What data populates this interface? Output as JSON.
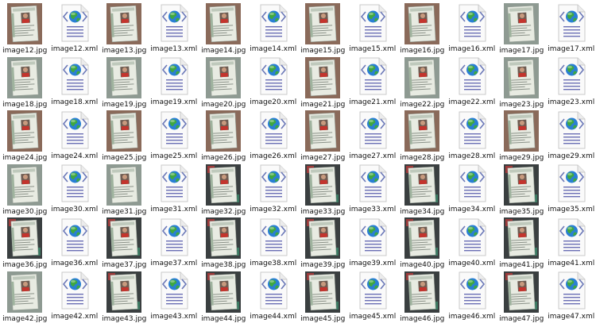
{
  "window": {
    "view": "large-icons"
  },
  "icons": {
    "jpg": "id-card-photo-thumbnail",
    "xml": "xml-document-icon"
  },
  "colors": {
    "label_text": "#111111",
    "xml_line": "#6b6fb5",
    "xml_globe_ocean": "#2a7fd4",
    "xml_globe_land": "#3fa83f",
    "xml_bracket": "#6b78b8",
    "photo_brown_bg": "#8a6a5a",
    "photo_gray_bg": "#8e9a92",
    "photo_dark_bg": "#3a3f40",
    "card_face": "#e8ebe2",
    "card_shirt": "#c4342d"
  },
  "files": [
    {
      "name": "image12.jpg",
      "type": "jpg",
      "bg": "brown"
    },
    {
      "name": "image12.xml",
      "type": "xml"
    },
    {
      "name": "image13.jpg",
      "type": "jpg",
      "bg": "brown"
    },
    {
      "name": "image13.xml",
      "type": "xml"
    },
    {
      "name": "image14.jpg",
      "type": "jpg",
      "bg": "brown"
    },
    {
      "name": "image14.xml",
      "type": "xml"
    },
    {
      "name": "image15.jpg",
      "type": "jpg",
      "bg": "brown"
    },
    {
      "name": "image15.xml",
      "type": "xml"
    },
    {
      "name": "image16.jpg",
      "type": "jpg",
      "bg": "brown"
    },
    {
      "name": "image16.xml",
      "type": "xml"
    },
    {
      "name": "image17.jpg",
      "type": "jpg",
      "bg": "gray"
    },
    {
      "name": "image17.xml",
      "type": "xml"
    },
    {
      "name": "image18.jpg",
      "type": "jpg",
      "bg": "gray"
    },
    {
      "name": "image18.xml",
      "type": "xml"
    },
    {
      "name": "image19.jpg",
      "type": "jpg",
      "bg": "gray"
    },
    {
      "name": "image19.xml",
      "type": "xml"
    },
    {
      "name": "image20.jpg",
      "type": "jpg",
      "bg": "gray"
    },
    {
      "name": "image20.xml",
      "type": "xml"
    },
    {
      "name": "image21.jpg",
      "type": "jpg",
      "bg": "brown"
    },
    {
      "name": "image21.xml",
      "type": "xml"
    },
    {
      "name": "image22.jpg",
      "type": "jpg",
      "bg": "gray"
    },
    {
      "name": "image22.xml",
      "type": "xml"
    },
    {
      "name": "image23.jpg",
      "type": "jpg",
      "bg": "gray"
    },
    {
      "name": "image23.xml",
      "type": "xml"
    },
    {
      "name": "image24.jpg",
      "type": "jpg",
      "bg": "brown"
    },
    {
      "name": "image24.xml",
      "type": "xml"
    },
    {
      "name": "image25.jpg",
      "type": "jpg",
      "bg": "brown"
    },
    {
      "name": "image25.xml",
      "type": "xml"
    },
    {
      "name": "image26.jpg",
      "type": "jpg",
      "bg": "brown"
    },
    {
      "name": "image26.xml",
      "type": "xml"
    },
    {
      "name": "image27.jpg",
      "type": "jpg",
      "bg": "brown"
    },
    {
      "name": "image27.xml",
      "type": "xml"
    },
    {
      "name": "image28.jpg",
      "type": "jpg",
      "bg": "brown"
    },
    {
      "name": "image28.xml",
      "type": "xml"
    },
    {
      "name": "image29.jpg",
      "type": "jpg",
      "bg": "brown"
    },
    {
      "name": "image29.xml",
      "type": "xml"
    },
    {
      "name": "image30.jpg",
      "type": "jpg",
      "bg": "gray"
    },
    {
      "name": "image30.xml",
      "type": "xml"
    },
    {
      "name": "image31.jpg",
      "type": "jpg",
      "bg": "gray"
    },
    {
      "name": "image31.xml",
      "type": "xml"
    },
    {
      "name": "image32.jpg",
      "type": "jpg",
      "bg": "dark"
    },
    {
      "name": "image32.xml",
      "type": "xml"
    },
    {
      "name": "image33.jpg",
      "type": "jpg",
      "bg": "dark"
    },
    {
      "name": "image33.xml",
      "type": "xml"
    },
    {
      "name": "image34.jpg",
      "type": "jpg",
      "bg": "dark"
    },
    {
      "name": "image34.xml",
      "type": "xml"
    },
    {
      "name": "image35.jpg",
      "type": "jpg",
      "bg": "dark"
    },
    {
      "name": "image35.xml",
      "type": "xml"
    },
    {
      "name": "image36.jpg",
      "type": "jpg",
      "bg": "dark"
    },
    {
      "name": "image36.xml",
      "type": "xml"
    },
    {
      "name": "image37.jpg",
      "type": "jpg",
      "bg": "dark"
    },
    {
      "name": "image37.xml",
      "type": "xml"
    },
    {
      "name": "image38.jpg",
      "type": "jpg",
      "bg": "dark"
    },
    {
      "name": "image38.xml",
      "type": "xml"
    },
    {
      "name": "image39.jpg",
      "type": "jpg",
      "bg": "dark"
    },
    {
      "name": "image39.xml",
      "type": "xml"
    },
    {
      "name": "image40.jpg",
      "type": "jpg",
      "bg": "dark"
    },
    {
      "name": "image40.xml",
      "type": "xml"
    },
    {
      "name": "image41.jpg",
      "type": "jpg",
      "bg": "dark"
    },
    {
      "name": "image41.xml",
      "type": "xml"
    },
    {
      "name": "image42.jpg",
      "type": "jpg",
      "bg": "gray"
    },
    {
      "name": "image42.xml",
      "type": "xml"
    },
    {
      "name": "image43.jpg",
      "type": "jpg",
      "bg": "dark"
    },
    {
      "name": "image43.xml",
      "type": "xml"
    },
    {
      "name": "image44.jpg",
      "type": "jpg",
      "bg": "dark"
    },
    {
      "name": "image44.xml",
      "type": "xml"
    },
    {
      "name": "image45.jpg",
      "type": "jpg",
      "bg": "dark"
    },
    {
      "name": "image45.xml",
      "type": "xml"
    },
    {
      "name": "image46.jpg",
      "type": "jpg",
      "bg": "dark"
    },
    {
      "name": "image46.xml",
      "type": "xml"
    },
    {
      "name": "image47.jpg",
      "type": "jpg",
      "bg": "dark"
    },
    {
      "name": "image47.xml",
      "type": "xml"
    }
  ]
}
